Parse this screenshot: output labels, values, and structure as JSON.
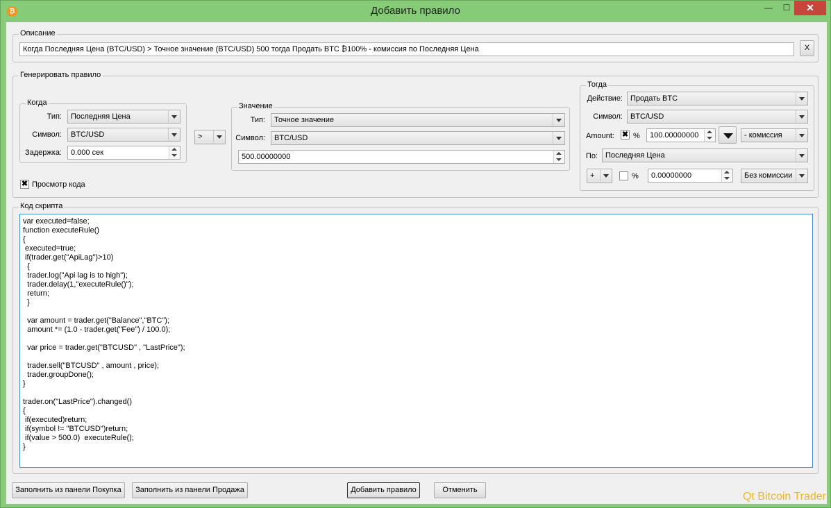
{
  "window": {
    "title": "Добавить правило",
    "minimize": "—",
    "maximize": "☐",
    "close": "✕",
    "app_icon": "₿"
  },
  "description": {
    "group": "Описание",
    "text": "Когда Последняя Цена (BTC/USD) > Точное значение (BTC/USD) 500 тогда Продать BTC ₿100% - комиссия по Последняя Цена",
    "clear_button": "X"
  },
  "generate": {
    "group": "Генерировать правило",
    "when": {
      "group": "Когда",
      "type_label": "Тип:",
      "type_value": "Последняя Цена",
      "symbol_label": "Символ:",
      "symbol_value": "BTC/USD",
      "delay_label": "Задержка:",
      "delay_value": "0.000 сек"
    },
    "operator": ">",
    "value": {
      "group": "Значение",
      "type_label": "Тип:",
      "type_value": "Точное значение",
      "symbol_label": "Символ:",
      "symbol_value": "BTC/USD",
      "amount_value": "500.00000000"
    },
    "then": {
      "group": "Тогда",
      "action_label": "Действие:",
      "action_value": "Продать BTC",
      "symbol_label": "Символ:",
      "symbol_value": "BTC/USD",
      "amount_label": "Amount:",
      "percent_sign": "%",
      "amount_value": "100.00000000",
      "fee_value": "- комиссия",
      "by_label": "По:",
      "by_value": "Последняя Цена",
      "plus_label": "+",
      "percent2_sign": "%",
      "price_offset_value": "0.00000000",
      "no_fee_value": "Без комиссии"
    },
    "preview_label": "Просмотр кода",
    "preview_checked": "✖"
  },
  "script": {
    "group": "Код скрипта",
    "code": "var executed=false;\nfunction executeRule()\n{\n executed=true;\n if(trader.get(\"ApiLag\")>10)\n  {\n  trader.log(\"Api lag is to high\");\n  trader.delay(1,\"executeRule()\");\n  return;\n  }\n\n  var amount = trader.get(\"Balance\",\"BTC\");\n  amount *= (1.0 - trader.get(\"Fee\") / 100.0);\n\n  var price = trader.get(\"BTCUSD\" , \"LastPrice\");\n\n  trader.sell(\"BTCUSD\" , amount , price);\n  trader.groupDone();\n}\n\ntrader.on(\"LastPrice\").changed()\n{\n if(executed)return;\n if(symbol != \"BTCUSD\")return;\n if(value > 500.0)  executeRule();\n}"
  },
  "buttons": {
    "fill_buy": "Заполнить из панели Покупка",
    "fill_sell": "Заполнить из панели Продажа",
    "add_rule": "Добавить правило",
    "cancel": "Отменить"
  },
  "brand": "Qt Bitcoin Trader"
}
